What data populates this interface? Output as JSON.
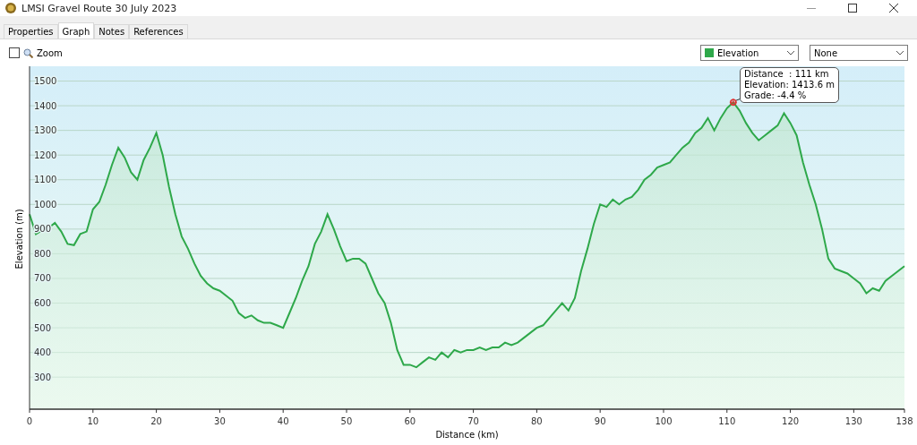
{
  "window": {
    "title": "LMSI Gravel Route 30 July 2023"
  },
  "tabs": [
    {
      "label": "Properties",
      "selected": false
    },
    {
      "label": "Graph",
      "selected": true
    },
    {
      "label": "Notes",
      "selected": false
    },
    {
      "label": "References",
      "selected": false
    }
  ],
  "toolbar": {
    "zoom": {
      "label": "Zoom",
      "checked": false
    },
    "second_select": {
      "value": "None"
    }
  },
  "tooltip": {
    "lines": [
      "Distance  : 111 km",
      "Elevation: 1413.6 m",
      "Grade: -4.4 %"
    ]
  },
  "chart_data": {
    "type": "area",
    "grid": true,
    "xlabel": "Distance  (km)",
    "ylabel": "Elevation (m)",
    "xlim": [
      0,
      138
    ],
    "ylim": [
      170,
      1560
    ],
    "xticks": [
      0,
      10,
      20,
      30,
      40,
      50,
      60,
      70,
      80,
      90,
      100,
      110,
      120,
      130,
      138
    ],
    "yticks": [
      300,
      400,
      500,
      600,
      700,
      800,
      900,
      1000,
      1100,
      1200,
      1300,
      1400,
      1500
    ],
    "x": [
      0,
      1,
      2,
      3,
      4,
      5,
      6,
      7,
      8,
      9,
      10,
      11,
      12,
      13,
      14,
      15,
      16,
      17,
      18,
      19,
      20,
      21,
      22,
      23,
      24,
      25,
      26,
      27,
      28,
      29,
      30,
      31,
      32,
      33,
      34,
      35,
      36,
      37,
      38,
      39,
      40,
      41,
      42,
      43,
      44,
      45,
      46,
      47,
      48,
      49,
      50,
      51,
      52,
      53,
      54,
      55,
      56,
      57,
      58,
      59,
      60,
      61,
      62,
      63,
      64,
      65,
      66,
      67,
      68,
      69,
      70,
      71,
      72,
      73,
      74,
      75,
      76,
      77,
      78,
      79,
      80,
      81,
      82,
      83,
      84,
      85,
      86,
      87,
      88,
      89,
      90,
      91,
      92,
      93,
      94,
      95,
      96,
      97,
      98,
      99,
      100,
      101,
      102,
      103,
      104,
      105,
      106,
      107,
      108,
      109,
      110,
      111,
      112,
      113,
      114,
      115,
      116,
      117,
      118,
      119,
      120,
      121,
      122,
      123,
      124,
      125,
      126,
      127,
      128,
      129,
      130,
      131,
      132,
      133,
      134,
      135,
      136,
      137,
      138
    ],
    "series": [
      {
        "name": "Elevation",
        "color": "#2ea84a",
        "values": [
          960,
          880,
          895,
          905,
          925,
          890,
          840,
          835,
          880,
          890,
          980,
          1010,
          1080,
          1160,
          1230,
          1190,
          1130,
          1100,
          1180,
          1230,
          1290,
          1200,
          1070,
          960,
          870,
          820,
          760,
          710,
          680,
          660,
          650,
          630,
          610,
          560,
          540,
          550,
          530,
          520,
          520,
          510,
          500,
          560,
          620,
          690,
          750,
          840,
          890,
          960,
          900,
          830,
          770,
          780,
          780,
          760,
          700,
          640,
          600,
          520,
          410,
          350,
          350,
          340,
          360,
          380,
          370,
          400,
          380,
          410,
          400,
          410,
          410,
          420,
          410,
          420,
          420,
          440,
          430,
          440,
          460,
          480,
          500,
          510,
          540,
          570,
          600,
          570,
          620,
          730,
          820,
          920,
          1000,
          990,
          1020,
          1000,
          1020,
          1030,
          1060,
          1100,
          1120,
          1150,
          1160,
          1170,
          1200,
          1230,
          1250,
          1290,
          1310,
          1350,
          1300,
          1350,
          1390,
          1414,
          1380,
          1330,
          1290,
          1260,
          1280,
          1300,
          1320,
          1370,
          1330,
          1280,
          1170,
          1080,
          1000,
          900,
          780,
          740,
          730,
          720,
          700,
          680,
          640,
          660,
          650,
          690,
          710,
          730,
          750
        ]
      }
    ]
  }
}
